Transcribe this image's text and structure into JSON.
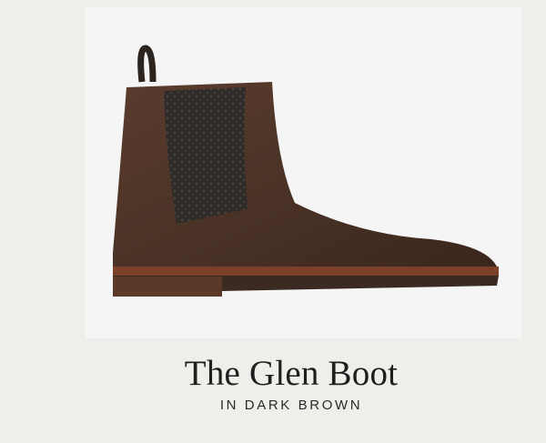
{
  "product": {
    "image_name": "chelsea-boot-photo",
    "title": "The Glen Boot",
    "subtitle": "IN DARK BROWN"
  },
  "colors": {
    "page_background": "#efeeea",
    "image_background": "#f5f5f5",
    "leather": "#4a3226",
    "elastic": "#2f2b28",
    "sole": "#7a4128",
    "text": "#1f1f1f"
  }
}
